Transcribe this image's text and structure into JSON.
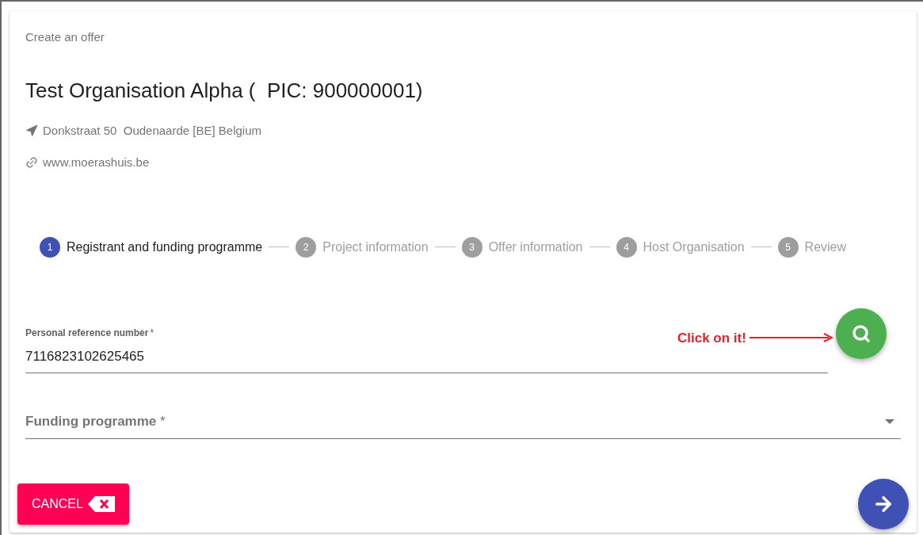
{
  "header": "Create an offer",
  "organisation": {
    "name": "Test Organisation Alpha (  PIC: 900000001)",
    "address": "Donkstraat 50  Oudenaarde [BE] Belgium",
    "website": "www.moerashuis.be"
  },
  "steps": [
    {
      "number": "1",
      "label": "Registrant and funding programme",
      "selected": true
    },
    {
      "number": "2",
      "label": "Project information",
      "selected": false
    },
    {
      "number": "3",
      "label": "Offer information",
      "selected": false
    },
    {
      "number": "4",
      "label": "Host Organisation",
      "selected": false
    },
    {
      "number": "5",
      "label": "Review",
      "selected": false
    }
  ],
  "reference_field": {
    "label": "Personal reference number",
    "required_mark": "*",
    "value": "7116823102625465"
  },
  "annotation": "Click on it!",
  "funding_field": {
    "placeholder": "Funding programme",
    "required_mark": "*"
  },
  "cancel_button": "CANCEL"
}
